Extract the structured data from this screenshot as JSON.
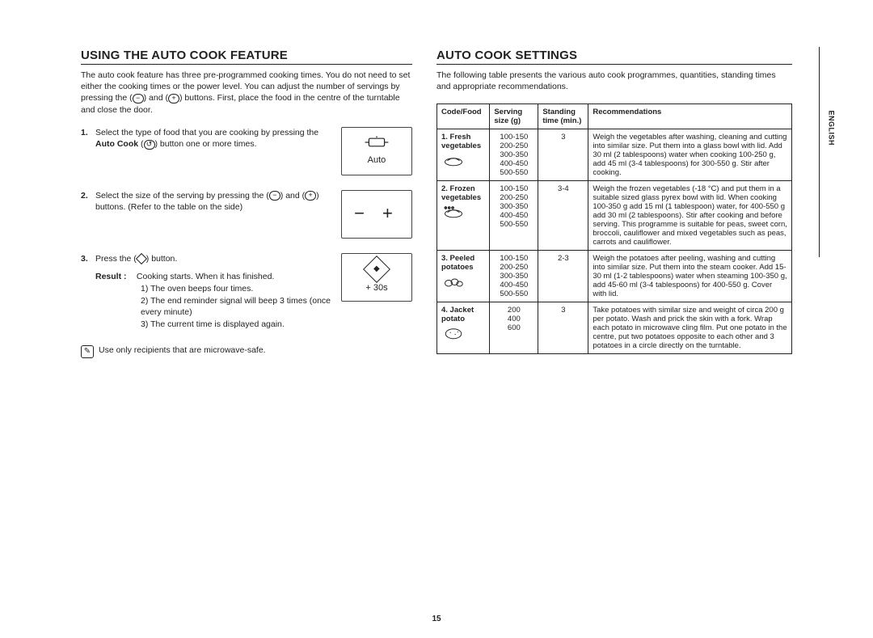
{
  "page_number": "15",
  "language_tab": "ENGLISH",
  "left": {
    "heading": "USING THE AUTO COOK FEATURE",
    "intro_pre": "The auto cook feature has three pre-programmed cooking times. You do not need to set either the cooking times or the power level. You can adjust the number of servings by pressing the ",
    "intro_mid": " and ",
    "intro_post": " buttons. First, place the food in the centre of the turntable and close the door.",
    "steps": {
      "s1_pre": "Select the type of food that you are cooking by pressing the ",
      "s1_bold": "Auto Cook",
      "s1_post": " button one or more times.",
      "s2_pre": "Select the size of the serving by pressing the ",
      "s2_mid": " and ",
      "s2_post": " buttons. (Refer to the table on the side)",
      "s3_pre": "Press the ",
      "s3_post": " button.",
      "result_label": "Result :",
      "result_text": "Cooking starts. When it has finished.",
      "result_items": [
        "1)  The oven beeps four times.",
        "2)  The end reminder signal will beep 3 times (once every minute)",
        "3)  The current time is displayed again."
      ],
      "panel_auto": "Auto",
      "panel_30s": "+ 30s"
    },
    "note": "Use only recipients that are microwave-safe."
  },
  "right": {
    "heading": "AUTO COOK SETTINGS",
    "intro": "The following table presents the various auto cook programmes, quantities, standing times and appropriate recommendations.",
    "headers": {
      "code": "Code/Food",
      "size": "Serving size (g)",
      "time": "Standing time (min.)",
      "rec": "Recommendations"
    },
    "rows": [
      {
        "food": "1. Fresh vegetables",
        "sizes": [
          "100-150",
          "200-250",
          "300-350",
          "400-450",
          "500-550"
        ],
        "time": "3",
        "rec": "Weigh the vegetables after washing, cleaning and cutting into similar size. Put them into a glass bowl with lid. Add 30 ml (2 tablespoons) water when cooking 100-250 g, add 45 ml (3-4 tablespoons) for 300-550 g. Stir after cooking."
      },
      {
        "food": "2. Frozen vegetables",
        "sizes": [
          "100-150",
          "200-250",
          "300-350",
          "400-450",
          "500-550"
        ],
        "time": "3-4",
        "rec": "Weigh the frozen vegetables (-18 °C) and put them in a suitable sized glass pyrex bowl with lid. When cooking 100-350 g add 15 ml (1 tablespoon) water, for 400-550 g add 30 ml (2 tablespoons). Stir after cooking and before serving. This programme is suitable for peas, sweet corn, broccoli, cauliflower and mixed vegetables such as peas, carrots and cauliflower."
      },
      {
        "food": "3. Peeled potatoes",
        "sizes": [
          "100-150",
          "200-250",
          "300-350",
          "400-450",
          "500-550"
        ],
        "time": "2-3",
        "rec": "Weigh the potatoes after peeling, washing and cutting into similar size. Put them into the steam cooker. Add 15-30 ml (1-2 tablespoons) water when steaming 100-350 g, add 45-60 ml (3-4 tablespoons) for 400-550 g. Cover with lid."
      },
      {
        "food": "4. Jacket potato",
        "sizes": [
          "200",
          "400",
          "600"
        ],
        "time": "3",
        "rec": "Take potatoes with similar size and weight of circa 200 g per potato. Wash and prick the skin with a fork. Wrap each potato in microwave cling film. Put one potato in the centre, put two potatoes opposite to each other and 3 potatoes in a circle directly on the turntable."
      }
    ]
  }
}
